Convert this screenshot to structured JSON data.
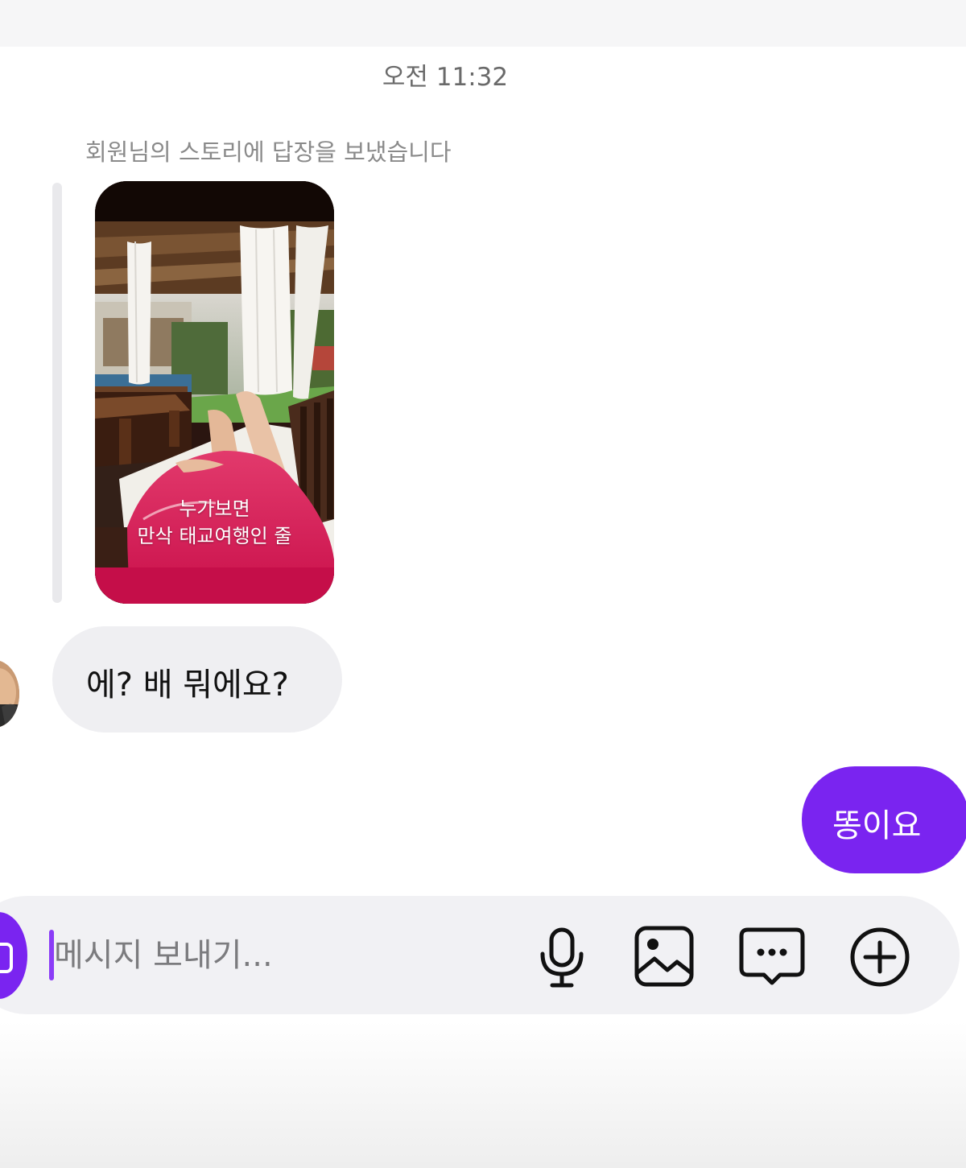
{
  "thread": {
    "timestamp": "오전 11:32",
    "story_caption": "회원님의 스토리에 답장을 보냈습니다",
    "story": {
      "overlay_line1": "누가보면",
      "overlay_line2": "만삭 태교여행인 줄"
    },
    "messages": [
      {
        "direction": "incoming",
        "text": "에? 배 뭐에요?"
      },
      {
        "direction": "outgoing",
        "text": "똥이요"
      }
    ]
  },
  "composer": {
    "placeholder": "메시지 보내기...",
    "icons": [
      "camera-icon",
      "microphone-icon",
      "gallery-icon",
      "sticker-icon",
      "plus-icon"
    ]
  },
  "colors": {
    "accent": "#7a24f0",
    "incoming_bubble": "#efeff2",
    "composer_bg": "#f1f1f4"
  }
}
